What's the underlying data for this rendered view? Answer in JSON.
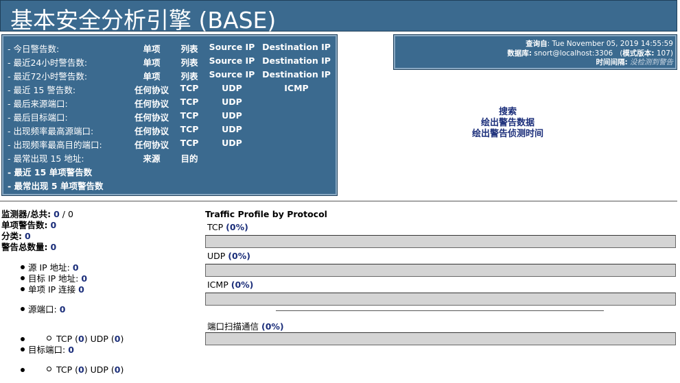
{
  "header": {
    "title": "基本安全分析引擎 (BASE)"
  },
  "alerts": {
    "rows": [
      {
        "label": "- 今日警告数:",
        "cols": [
          "单项",
          "列表",
          "Source IP",
          "Destination IP"
        ]
      },
      {
        "label": "- 最近24小时警告数:",
        "cols": [
          "单项",
          "列表",
          "Source IP",
          "Destination IP"
        ]
      },
      {
        "label": "- 最近72小时警告数:",
        "cols": [
          "单项",
          "列表",
          "Source IP",
          "Destination IP"
        ]
      },
      {
        "label": "- 最近 15 警告数:",
        "cols": [
          "任何协议",
          "TCP",
          "UDP",
          "ICMP"
        ]
      },
      {
        "label": "- 最后来源端口:",
        "cols": [
          "任何协议",
          "TCP",
          "UDP"
        ]
      },
      {
        "label": "- 最后目标端口:",
        "cols": [
          "任何协议",
          "TCP",
          "UDP"
        ]
      },
      {
        "label": "- 出现频率最高源端口:",
        "cols": [
          "任何协议",
          "TCP",
          "UDP"
        ]
      },
      {
        "label": "- 出现频率最高目的端口:",
        "cols": [
          "任何协议",
          "TCP",
          "UDP"
        ]
      },
      {
        "label": "- 最常出现 15 地址:",
        "cols": [
          "来源",
          "目的"
        ]
      },
      {
        "label": "- 最近 15 单项警告数",
        "cols": []
      },
      {
        "label": "- 最常出现 5 单项警告数",
        "cols": []
      }
    ]
  },
  "info": {
    "queried_label": "查询自",
    "queried_value": ": Tue November 05, 2019 14:55:59",
    "db_label": "数据库:",
    "db_value": " snort@localhost:3306",
    "schema_label": "模式版本:",
    "schema_value": " 107",
    "time_label": "时间间隔:",
    "time_value": " 没检测到警告"
  },
  "links": {
    "search": "搜索",
    "graph_alert_data": "绘出警告数据",
    "graph_alert_time": "绘出警告侦测时间"
  },
  "stats": {
    "sensors_label": "监测器/总共:",
    "sensors_value": "0",
    "sensors_total": "0",
    "unique_alerts_label": "单项警告数:",
    "unique_alerts_value": "0",
    "categories_label": "分类:",
    "categories_value": "0",
    "total_alerts_label": "警告总数量:",
    "total_alerts_value": "0",
    "src_ip_label": "源 IP 地址:",
    "src_ip_value": "0",
    "dst_ip_label": "目标 IP 地址:",
    "dst_ip_value": "0",
    "unique_ip_label": "单项 IP 连接",
    "unique_ip_value": "0",
    "src_port_label": "源端口:",
    "src_port_value": "0",
    "src_tcp_label": "TCP (",
    "src_tcp_value": "0",
    "src_udp_label": ")  UDP (",
    "src_udp_value": "0",
    "dst_port_label": "目标端口:",
    "dst_port_value": "0",
    "dst_tcp_label": "TCP (",
    "dst_tcp_value": "0",
    "dst_udp_label": ")  UDP (",
    "dst_udp_value": "0",
    "close_paren": ")"
  },
  "profile": {
    "title": "Traffic Profile by Protocol",
    "tcp_label": "TCP",
    "tcp_pct": "(0%)",
    "udp_label": "UDP",
    "udp_pct": "(0%)",
    "icmp_label": "ICMP",
    "icmp_pct": "(0%)",
    "portscan_label": "端口扫描通信",
    "portscan_pct": "(0%)"
  }
}
